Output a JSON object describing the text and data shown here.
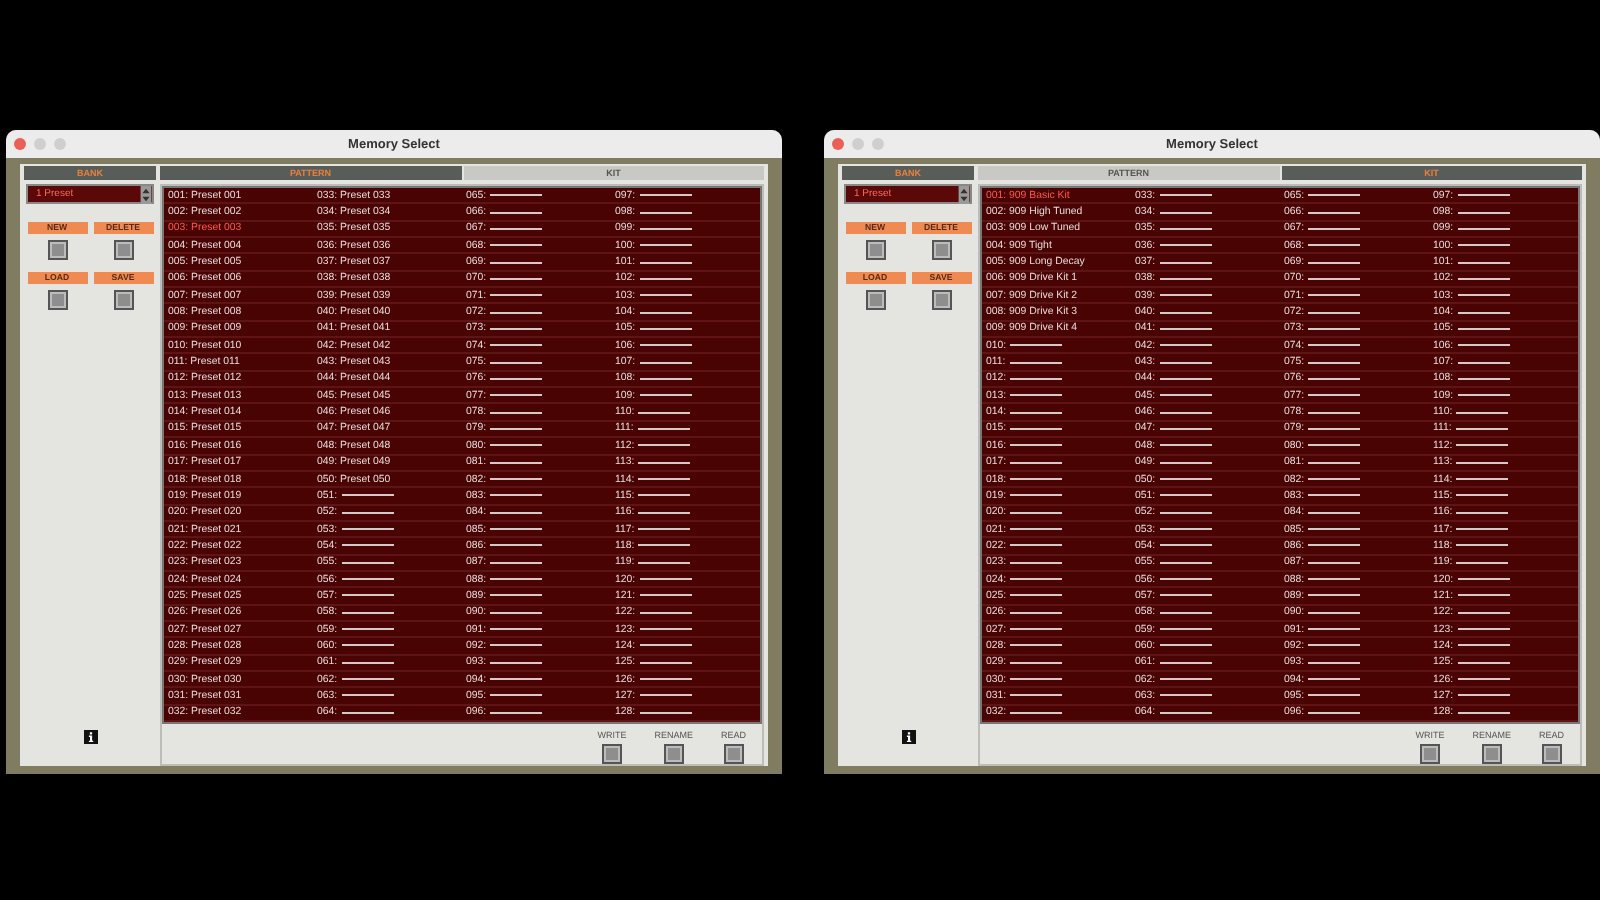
{
  "windows": [
    {
      "title": "Memory Select",
      "bank_header": "BANK",
      "bank_value": "1 Preset",
      "tabs": [
        {
          "label": "PATTERN",
          "selected": true
        },
        {
          "label": "KIT",
          "selected": false
        }
      ],
      "bank_buttons": [
        "NEW",
        "DELETE",
        "LOAD",
        "SAVE"
      ],
      "action_buttons": [
        "WRITE",
        "RENAME",
        "READ"
      ],
      "slots": [
        {
          "number": "001:",
          "label": "Preset 001",
          "selected": false
        },
        {
          "number": "002:",
          "label": "Preset 002",
          "selected": false
        },
        {
          "number": "003:",
          "label": "Preset 003",
          "selected": true
        },
        {
          "number": "004:",
          "label": "Preset 004",
          "selected": false
        },
        {
          "number": "005:",
          "label": "Preset 005",
          "selected": false
        },
        {
          "number": "006:",
          "label": "Preset 006",
          "selected": false
        },
        {
          "number": "007:",
          "label": "Preset 007",
          "selected": false
        },
        {
          "number": "008:",
          "label": "Preset 008",
          "selected": false
        },
        {
          "number": "009:",
          "label": "Preset 009",
          "selected": false
        },
        {
          "number": "010:",
          "label": "Preset 010",
          "selected": false
        },
        {
          "number": "011:",
          "label": "Preset 011",
          "selected": false
        },
        {
          "number": "012:",
          "label": "Preset 012",
          "selected": false
        },
        {
          "number": "013:",
          "label": "Preset 013",
          "selected": false
        },
        {
          "number": "014:",
          "label": "Preset 014",
          "selected": false
        },
        {
          "number": "015:",
          "label": "Preset 015",
          "selected": false
        },
        {
          "number": "016:",
          "label": "Preset 016",
          "selected": false
        },
        {
          "number": "017:",
          "label": "Preset 017",
          "selected": false
        },
        {
          "number": "018:",
          "label": "Preset 018",
          "selected": false
        },
        {
          "number": "019:",
          "label": "Preset 019",
          "selected": false
        },
        {
          "number": "020:",
          "label": "Preset 020",
          "selected": false
        },
        {
          "number": "021:",
          "label": "Preset 021",
          "selected": false
        },
        {
          "number": "022:",
          "label": "Preset 022",
          "selected": false
        },
        {
          "number": "023:",
          "label": "Preset 023",
          "selected": false
        },
        {
          "number": "024:",
          "label": "Preset 024",
          "selected": false
        },
        {
          "number": "025:",
          "label": "Preset 025",
          "selected": false
        },
        {
          "number": "026:",
          "label": "Preset 026",
          "selected": false
        },
        {
          "number": "027:",
          "label": "Preset 027",
          "selected": false
        },
        {
          "number": "028:",
          "label": "Preset 028",
          "selected": false
        },
        {
          "number": "029:",
          "label": "Preset 029",
          "selected": false
        },
        {
          "number": "030:",
          "label": "Preset 030",
          "selected": false
        },
        {
          "number": "031:",
          "label": "Preset 031",
          "selected": false
        },
        {
          "number": "032:",
          "label": "Preset 032",
          "selected": false
        },
        {
          "number": "033:",
          "label": "Preset 033",
          "selected": false
        },
        {
          "number": "034:",
          "label": "Preset 034",
          "selected": false
        },
        {
          "number": "035:",
          "label": "Preset 035",
          "selected": false
        },
        {
          "number": "036:",
          "label": "Preset 036",
          "selected": false
        },
        {
          "number": "037:",
          "label": "Preset 037",
          "selected": false
        },
        {
          "number": "038:",
          "label": "Preset 038",
          "selected": false
        },
        {
          "number": "039:",
          "label": "Preset 039",
          "selected": false
        },
        {
          "number": "040:",
          "label": "Preset 040",
          "selected": false
        },
        {
          "number": "041:",
          "label": "Preset 041",
          "selected": false
        },
        {
          "number": "042:",
          "label": "Preset 042",
          "selected": false
        },
        {
          "number": "043:",
          "label": "Preset 043",
          "selected": false
        },
        {
          "number": "044:",
          "label": "Preset 044",
          "selected": false
        },
        {
          "number": "045:",
          "label": "Preset 045",
          "selected": false
        },
        {
          "number": "046:",
          "label": "Preset 046",
          "selected": false
        },
        {
          "number": "047:",
          "label": "Preset 047",
          "selected": false
        },
        {
          "number": "048:",
          "label": "Preset 048",
          "selected": false
        },
        {
          "number": "049:",
          "label": "Preset 049",
          "selected": false
        },
        {
          "number": "050:",
          "label": "Preset 050",
          "selected": false
        },
        {
          "number": "051:",
          "selected": false
        },
        {
          "number": "052:",
          "selected": false
        },
        {
          "number": "053:",
          "selected": false
        },
        {
          "number": "054:",
          "selected": false
        },
        {
          "number": "055:",
          "selected": false
        },
        {
          "number": "056:",
          "selected": false
        },
        {
          "number": "057:",
          "selected": false
        },
        {
          "number": "058:",
          "selected": false
        },
        {
          "number": "059:",
          "selected": false
        },
        {
          "number": "060:",
          "selected": false
        },
        {
          "number": "061:",
          "selected": false
        },
        {
          "number": "062:",
          "selected": false
        },
        {
          "number": "063:",
          "selected": false
        },
        {
          "number": "064:",
          "selected": false
        },
        {
          "number": "065:",
          "selected": false
        },
        {
          "number": "066:",
          "selected": false
        },
        {
          "number": "067:",
          "selected": false
        },
        {
          "number": "068:",
          "selected": false
        },
        {
          "number": "069:",
          "selected": false
        },
        {
          "number": "070:",
          "selected": false
        },
        {
          "number": "071:",
          "selected": false
        },
        {
          "number": "072:",
          "selected": false
        },
        {
          "number": "073:",
          "selected": false
        },
        {
          "number": "074:",
          "selected": false
        },
        {
          "number": "075:",
          "selected": false
        },
        {
          "number": "076:",
          "selected": false
        },
        {
          "number": "077:",
          "selected": false
        },
        {
          "number": "078:",
          "selected": false
        },
        {
          "number": "079:",
          "selected": false
        },
        {
          "number": "080:",
          "selected": false
        },
        {
          "number": "081:",
          "selected": false
        },
        {
          "number": "082:",
          "selected": false
        },
        {
          "number": "083:",
          "selected": false
        },
        {
          "number": "084:",
          "selected": false
        },
        {
          "number": "085:",
          "selected": false
        },
        {
          "number": "086:",
          "selected": false
        },
        {
          "number": "087:",
          "selected": false
        },
        {
          "number": "088:",
          "selected": false
        },
        {
          "number": "089:",
          "selected": false
        },
        {
          "number": "090:",
          "selected": false
        },
        {
          "number": "091:",
          "selected": false
        },
        {
          "number": "092:",
          "selected": false
        },
        {
          "number": "093:",
          "selected": false
        },
        {
          "number": "094:",
          "selected": false
        },
        {
          "number": "095:",
          "selected": false
        },
        {
          "number": "096:",
          "selected": false
        },
        {
          "number": "097:",
          "selected": false
        },
        {
          "number": "098:",
          "selected": false
        },
        {
          "number": "099:",
          "selected": false
        },
        {
          "number": "100:",
          "selected": false
        },
        {
          "number": "101:",
          "selected": false
        },
        {
          "number": "102:",
          "selected": false
        },
        {
          "number": "103:",
          "selected": false
        },
        {
          "number": "104:",
          "selected": false
        },
        {
          "number": "105:",
          "selected": false
        },
        {
          "number": "106:",
          "selected": false
        },
        {
          "number": "107:",
          "selected": false
        },
        {
          "number": "108:",
          "selected": false
        },
        {
          "number": "109:",
          "selected": false
        },
        {
          "number": "110:",
          "selected": false
        },
        {
          "number": "111:",
          "selected": false
        },
        {
          "number": "112:",
          "selected": false
        },
        {
          "number": "113:",
          "selected": false
        },
        {
          "number": "114:",
          "selected": false
        },
        {
          "number": "115:",
          "selected": false
        },
        {
          "number": "116:",
          "selected": false
        },
        {
          "number": "117:",
          "selected": false
        },
        {
          "number": "118:",
          "selected": false
        },
        {
          "number": "119:",
          "selected": false
        },
        {
          "number": "120:",
          "selected": false
        },
        {
          "number": "121:",
          "selected": false
        },
        {
          "number": "122:",
          "selected": false
        },
        {
          "number": "123:",
          "selected": false
        },
        {
          "number": "124:",
          "selected": false
        },
        {
          "number": "125:",
          "selected": false
        },
        {
          "number": "126:",
          "selected": false
        },
        {
          "number": "127:",
          "selected": false
        },
        {
          "number": "128:",
          "selected": false
        }
      ]
    },
    {
      "title": "Memory Select",
      "bank_header": "BANK",
      "bank_value": "1 Preset",
      "tabs": [
        {
          "label": "PATTERN",
          "selected": false
        },
        {
          "label": "KIT",
          "selected": true
        }
      ],
      "bank_buttons": [
        "NEW",
        "DELETE",
        "LOAD",
        "SAVE"
      ],
      "action_buttons": [
        "WRITE",
        "RENAME",
        "READ"
      ],
      "slots": [
        {
          "number": "001:",
          "label": "909 Basic Kit",
          "selected": true
        },
        {
          "number": "002:",
          "label": "909 High Tuned",
          "selected": false
        },
        {
          "number": "003:",
          "label": "909 Low Tuned",
          "selected": false
        },
        {
          "number": "004:",
          "label": "909 Tight",
          "selected": false
        },
        {
          "number": "005:",
          "label": "909 Long Decay",
          "selected": false
        },
        {
          "number": "006:",
          "label": "909 Drive Kit 1",
          "selected": false
        },
        {
          "number": "007:",
          "label": "909 Drive Kit 2",
          "selected": false
        },
        {
          "number": "008:",
          "label": "909 Drive Kit 3",
          "selected": false
        },
        {
          "number": "009:",
          "label": "909 Drive Kit 4",
          "selected": false
        },
        {
          "number": "010:",
          "selected": false
        },
        {
          "number": "011:",
          "selected": false
        },
        {
          "number": "012:",
          "selected": false
        },
        {
          "number": "013:",
          "selected": false
        },
        {
          "number": "014:",
          "selected": false
        },
        {
          "number": "015:",
          "selected": false
        },
        {
          "number": "016:",
          "selected": false
        },
        {
          "number": "017:",
          "selected": false
        },
        {
          "number": "018:",
          "selected": false
        },
        {
          "number": "019:",
          "selected": false
        },
        {
          "number": "020:",
          "selected": false
        },
        {
          "number": "021:",
          "selected": false
        },
        {
          "number": "022:",
          "selected": false
        },
        {
          "number": "023:",
          "selected": false
        },
        {
          "number": "024:",
          "selected": false
        },
        {
          "number": "025:",
          "selected": false
        },
        {
          "number": "026:",
          "selected": false
        },
        {
          "number": "027:",
          "selected": false
        },
        {
          "number": "028:",
          "selected": false
        },
        {
          "number": "029:",
          "selected": false
        },
        {
          "number": "030:",
          "selected": false
        },
        {
          "number": "031:",
          "selected": false
        },
        {
          "number": "032:",
          "selected": false
        },
        {
          "number": "033:",
          "selected": false
        },
        {
          "number": "034:",
          "selected": false
        },
        {
          "number": "035:",
          "selected": false
        },
        {
          "number": "036:",
          "selected": false
        },
        {
          "number": "037:",
          "selected": false
        },
        {
          "number": "038:",
          "selected": false
        },
        {
          "number": "039:",
          "selected": false
        },
        {
          "number": "040:",
          "selected": false
        },
        {
          "number": "041:",
          "selected": false
        },
        {
          "number": "042:",
          "selected": false
        },
        {
          "number": "043:",
          "selected": false
        },
        {
          "number": "044:",
          "selected": false
        },
        {
          "number": "045:",
          "selected": false
        },
        {
          "number": "046:",
          "selected": false
        },
        {
          "number": "047:",
          "selected": false
        },
        {
          "number": "048:",
          "selected": false
        },
        {
          "number": "049:",
          "selected": false
        },
        {
          "number": "050:",
          "selected": false
        },
        {
          "number": "051:",
          "selected": false
        },
        {
          "number": "052:",
          "selected": false
        },
        {
          "number": "053:",
          "selected": false
        },
        {
          "number": "054:",
          "selected": false
        },
        {
          "number": "055:",
          "selected": false
        },
        {
          "number": "056:",
          "selected": false
        },
        {
          "number": "057:",
          "selected": false
        },
        {
          "number": "058:",
          "selected": false
        },
        {
          "number": "059:",
          "selected": false
        },
        {
          "number": "060:",
          "selected": false
        },
        {
          "number": "061:",
          "selected": false
        },
        {
          "number": "062:",
          "selected": false
        },
        {
          "number": "063:",
          "selected": false
        },
        {
          "number": "064:",
          "selected": false
        },
        {
          "number": "065:",
          "selected": false
        },
        {
          "number": "066:",
          "selected": false
        },
        {
          "number": "067:",
          "selected": false
        },
        {
          "number": "068:",
          "selected": false
        },
        {
          "number": "069:",
          "selected": false
        },
        {
          "number": "070:",
          "selected": false
        },
        {
          "number": "071:",
          "selected": false
        },
        {
          "number": "072:",
          "selected": false
        },
        {
          "number": "073:",
          "selected": false
        },
        {
          "number": "074:",
          "selected": false
        },
        {
          "number": "075:",
          "selected": false
        },
        {
          "number": "076:",
          "selected": false
        },
        {
          "number": "077:",
          "selected": false
        },
        {
          "number": "078:",
          "selected": false
        },
        {
          "number": "079:",
          "selected": false
        },
        {
          "number": "080:",
          "selected": false
        },
        {
          "number": "081:",
          "selected": false
        },
        {
          "number": "082:",
          "selected": false
        },
        {
          "number": "083:",
          "selected": false
        },
        {
          "number": "084:",
          "selected": false
        },
        {
          "number": "085:",
          "selected": false
        },
        {
          "number": "086:",
          "selected": false
        },
        {
          "number": "087:",
          "selected": false
        },
        {
          "number": "088:",
          "selected": false
        },
        {
          "number": "089:",
          "selected": false
        },
        {
          "number": "090:",
          "selected": false
        },
        {
          "number": "091:",
          "selected": false
        },
        {
          "number": "092:",
          "selected": false
        },
        {
          "number": "093:",
          "selected": false
        },
        {
          "number": "094:",
          "selected": false
        },
        {
          "number": "095:",
          "selected": false
        },
        {
          "number": "096:",
          "selected": false
        },
        {
          "number": "097:",
          "selected": false
        },
        {
          "number": "098:",
          "selected": false
        },
        {
          "number": "099:",
          "selected": false
        },
        {
          "number": "100:",
          "selected": false
        },
        {
          "number": "101:",
          "selected": false
        },
        {
          "number": "102:",
          "selected": false
        },
        {
          "number": "103:",
          "selected": false
        },
        {
          "number": "104:",
          "selected": false
        },
        {
          "number": "105:",
          "selected": false
        },
        {
          "number": "106:",
          "selected": false
        },
        {
          "number": "107:",
          "selected": false
        },
        {
          "number": "108:",
          "selected": false
        },
        {
          "number": "109:",
          "selected": false
        },
        {
          "number": "110:",
          "selected": false
        },
        {
          "number": "111:",
          "selected": false
        },
        {
          "number": "112:",
          "selected": false
        },
        {
          "number": "113:",
          "selected": false
        },
        {
          "number": "114:",
          "selected": false
        },
        {
          "number": "115:",
          "selected": false
        },
        {
          "number": "116:",
          "selected": false
        },
        {
          "number": "117:",
          "selected": false
        },
        {
          "number": "118:",
          "selected": false
        },
        {
          "number": "119:",
          "selected": false
        },
        {
          "number": "120:",
          "selected": false
        },
        {
          "number": "121:",
          "selected": false
        },
        {
          "number": "122:",
          "selected": false
        },
        {
          "number": "123:",
          "selected": false
        },
        {
          "number": "124:",
          "selected": false
        },
        {
          "number": "125:",
          "selected": false
        },
        {
          "number": "126:",
          "selected": false
        },
        {
          "number": "127:",
          "selected": false
        },
        {
          "number": "128:",
          "selected": false
        }
      ]
    }
  ]
}
